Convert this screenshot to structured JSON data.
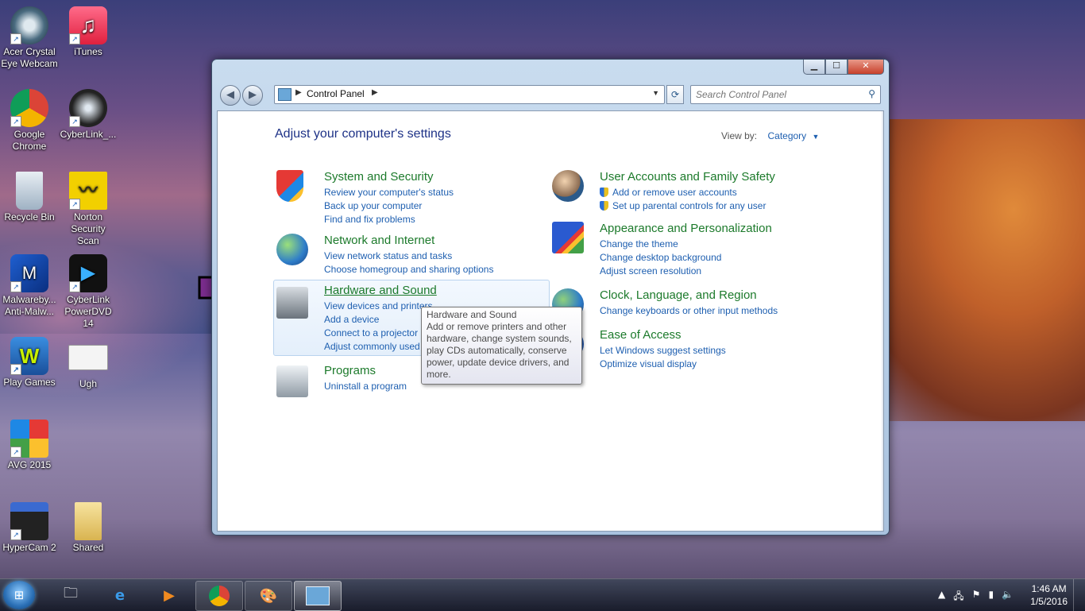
{
  "desktop": {
    "icons": [
      {
        "label": "Acer Crystal Eye Webcam"
      },
      {
        "label": "iTunes"
      },
      {
        "label": "Google Chrome"
      },
      {
        "label": "CyberLink_..."
      },
      {
        "label": "Recycle Bin"
      },
      {
        "label": "Norton Security Scan"
      },
      {
        "label": "Malwareby... Anti-Malw..."
      },
      {
        "label": "CyberLink PowerDVD 14"
      },
      {
        "label": "Play Games"
      },
      {
        "label": "Ugh"
      },
      {
        "label": "AVG 2015"
      },
      {
        "label": "HyperCam 2"
      },
      {
        "label": "Shared"
      }
    ]
  },
  "window": {
    "address": {
      "crumb": "Control Panel"
    },
    "search": {
      "placeholder": "Search Control Panel"
    },
    "heading": "Adjust your computer's settings",
    "view_by": {
      "label": "View by:",
      "value": "Category"
    },
    "categories": [
      {
        "title": "System and Security",
        "links": [
          "Review your computer's status",
          "Back up your computer",
          "Find and fix problems"
        ]
      },
      {
        "title": "Network and Internet",
        "links": [
          "View network status and tasks",
          "Choose homegroup and sharing options"
        ]
      },
      {
        "title": "Hardware and Sound",
        "links": [
          "View devices and printers",
          "Add a device",
          "Connect to a projector",
          "Adjust commonly used"
        ]
      },
      {
        "title": "Programs",
        "links": [
          "Uninstall a program"
        ]
      },
      {
        "title": "User Accounts and Family Safety",
        "links": [
          "Add or remove user accounts",
          "Set up parental controls for any user"
        ]
      },
      {
        "title": "Appearance and Personalization",
        "links": [
          "Change the theme",
          "Change desktop background",
          "Adjust screen resolution"
        ]
      },
      {
        "title": "Clock, Language, and Region",
        "links": [
          "Change keyboards or other input methods"
        ]
      },
      {
        "title": "Ease of Access",
        "links": [
          "Let Windows suggest settings",
          "Optimize visual display"
        ]
      }
    ],
    "tooltip": {
      "title": "Hardware and Sound",
      "body": "Add or remove printers and other hardware, change system sounds, play CDs automatically, conserve power, update device drivers, and more."
    }
  },
  "taskbar": {
    "clock": {
      "time": "1:46 AM",
      "date": "1/5/2016"
    }
  },
  "colors": {
    "category_title": "#1c7a2b",
    "link": "#1e5fb0",
    "heading": "#1e3287",
    "arrow": "#7b2d8e"
  }
}
